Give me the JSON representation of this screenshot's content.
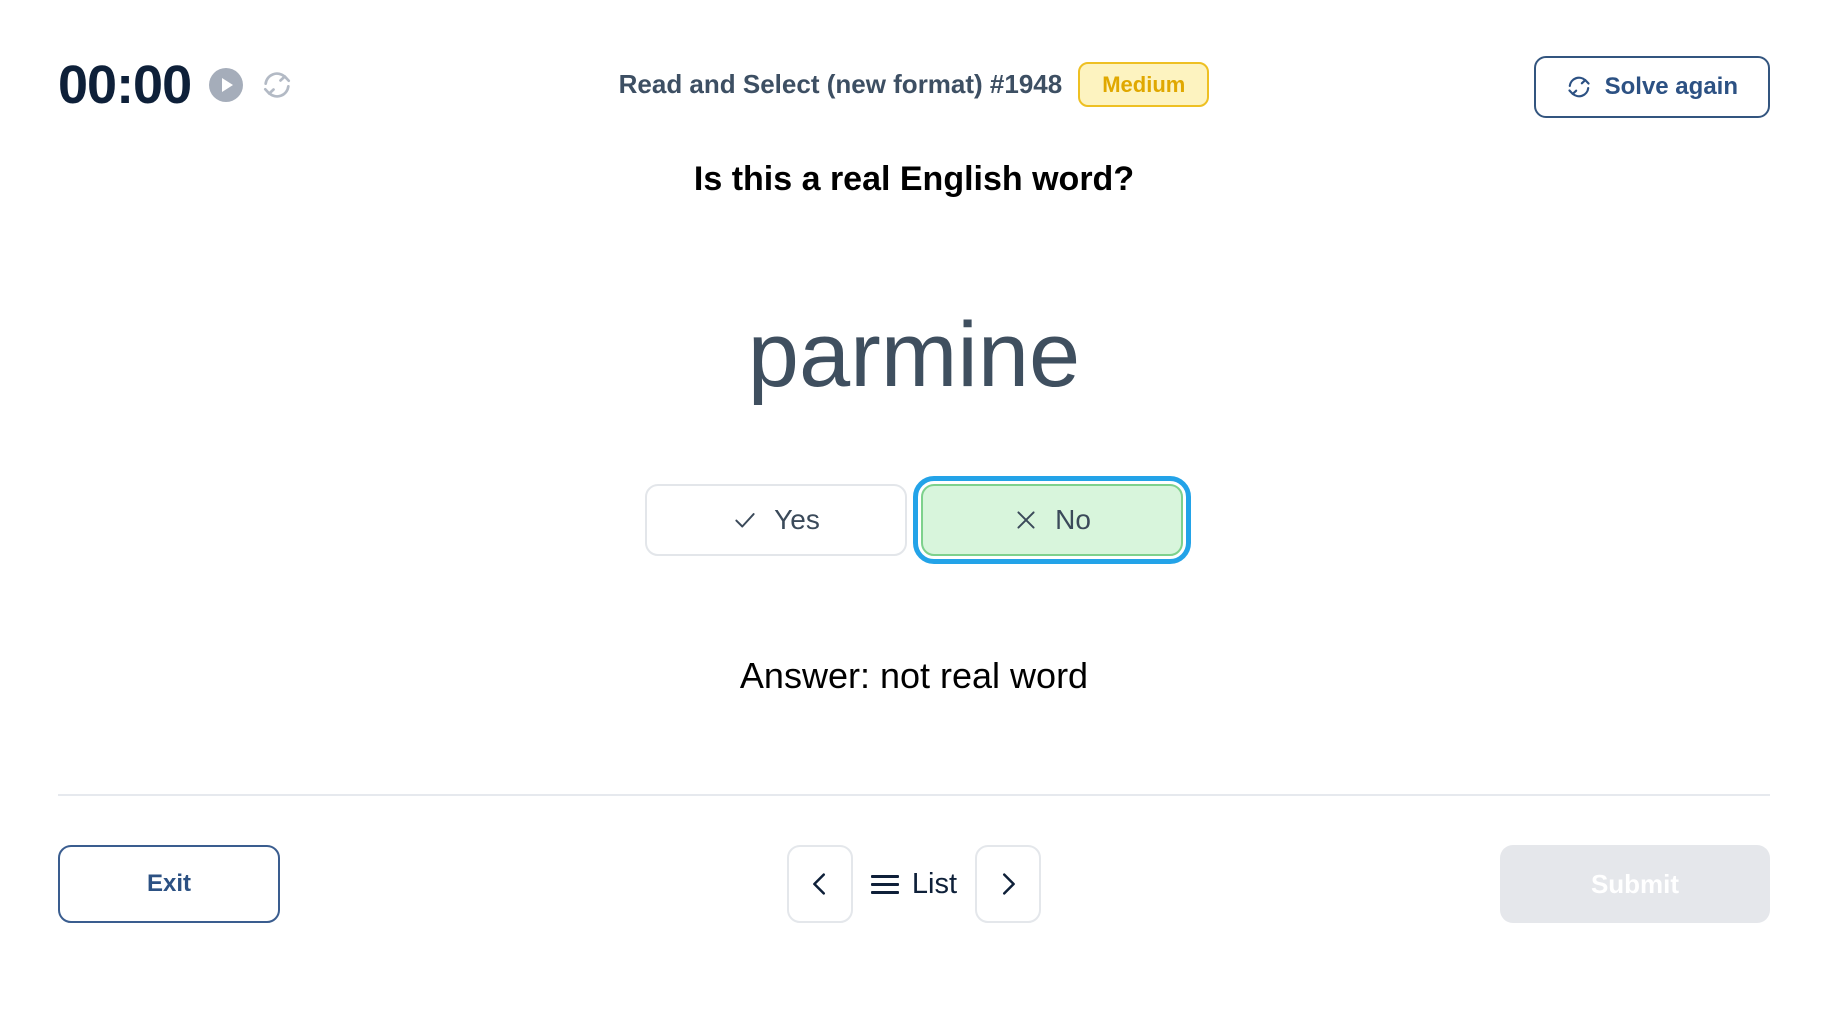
{
  "header": {
    "timer": "00:00",
    "play_icon": "play-icon",
    "reset_icon": "refresh-icon",
    "quiz_title": "Read and Select (new format) #1948",
    "difficulty": "Medium",
    "solve_again_label": "Solve again",
    "solve_again_icon": "refresh-icon"
  },
  "main": {
    "question": "Is this a real English word?",
    "word": "parmine",
    "choices": [
      {
        "label": "Yes",
        "icon": "check-icon",
        "selected": false
      },
      {
        "label": "No",
        "icon": "cross-icon",
        "selected": true
      }
    ],
    "answer": "Answer: not real word"
  },
  "footer": {
    "exit_label": "Exit",
    "prev_icon": "chevron-left-icon",
    "list_label": "List",
    "list_icon": "hamburger-icon",
    "next_icon": "chevron-right-icon",
    "submit_label": "Submit"
  },
  "colors": {
    "accent_navy": "#2c5183",
    "badge_bg": "#fdf3c0",
    "badge_border": "#eec023",
    "badge_text": "#e0a800",
    "selected_bg": "#d8f5dc",
    "selected_border": "#7dd18c",
    "focus_ring": "#23a3e8",
    "word_color": "#3f4f5f",
    "submit_disabled_bg": "#e5e7eb"
  }
}
